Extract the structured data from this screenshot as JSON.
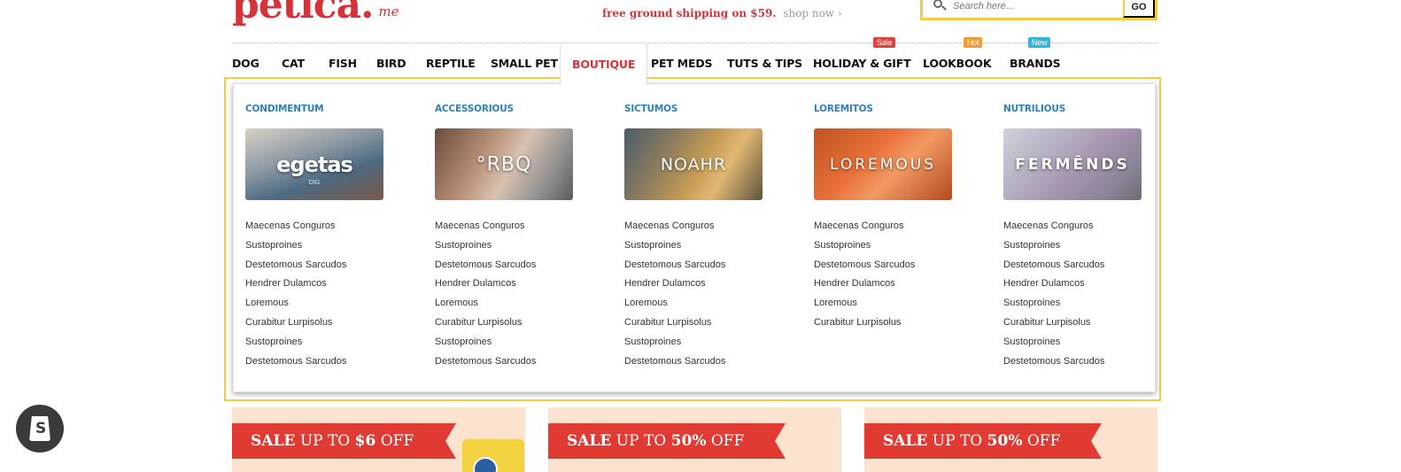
{
  "header": {
    "logo_text": "petica.",
    "logo_suffix": "me",
    "promo_red": "free ground shipping on $59.",
    "promo_link": "shop now ›",
    "search_placeholder": "Search here...",
    "search_button": "GO"
  },
  "nav": {
    "items": [
      {
        "label": "DOG"
      },
      {
        "label": "CAT"
      },
      {
        "label": "FISH"
      },
      {
        "label": "BIRD"
      },
      {
        "label": "REPTILE"
      },
      {
        "label": "SMALL PET"
      },
      {
        "label": "BOUTIQUE",
        "active": true
      },
      {
        "label": "PET MEDS"
      },
      {
        "label": "TUTS & TIPS"
      },
      {
        "label": "HOLIDAY & GIFT",
        "badge": "Sale"
      },
      {
        "label": "LOOKBOOK",
        "badge": "Hot"
      },
      {
        "label": "BRANDS",
        "badge": "New"
      }
    ]
  },
  "badge_colors": {
    "Sale": "#e0423e",
    "Hot": "#f09a3a",
    "New": "#2fb5e0"
  },
  "mega_menu": {
    "columns": [
      {
        "title": "CONDIMENTUM",
        "banner_text": "egetas",
        "banner_sub": "DIG",
        "links": [
          "Maecenas Conguros",
          "Sustoproines",
          "Destetomous Sarcudos",
          "Hendrer Dulamcos",
          "Loremous",
          "Curabitur Lurpisolus",
          "Sustoproines",
          "Destetomous Sarcudos"
        ]
      },
      {
        "title": "ACCESSORIOUS",
        "banner_text": "°RBQ",
        "links": [
          "Maecenas Conguros",
          "Sustoproines",
          "Destetomous Sarcudos",
          "Hendrer Dulamcos",
          "Loremous",
          "Curabitur Lurpisolus",
          "Sustoproines",
          "Destetomous Sarcudos"
        ]
      },
      {
        "title": "SICTUMOS",
        "banner_text": "NOAHR",
        "links": [
          "Maecenas Conguros",
          "Sustoproines",
          "Destetomous Sarcudos",
          "Hendrer Dulamcos",
          "Loremous",
          "Curabitur Lurpisolus",
          "Sustoproines",
          "Destetomous Sarcudos"
        ]
      },
      {
        "title": "LOREMITOS",
        "banner_text": "LOREMOUS",
        "links": [
          "Maecenas Conguros",
          "Sustoproines",
          "Destetomous Sarcudos",
          "Hendrer Dulamcos",
          "Loremous",
          "Curabitur Lurpisolus"
        ]
      },
      {
        "title": "NUTRILIOUS",
        "banner_text": "FERMĒNDS",
        "links": [
          "Maecenas Conguros",
          "Sustoproines",
          "Destetomous Sarcudos",
          "Hendrer Dulamcos",
          "Sustoproines",
          "Curabitur Lurpisolus",
          "Sustoproines",
          "Destetomous Sarcudos"
        ]
      }
    ]
  },
  "sales": [
    {
      "prefix": "SALE",
      "text": "UP TO",
      "amount": "$6",
      "suffix": "OFF"
    },
    {
      "prefix": "SALE",
      "text": "UP TO",
      "amount": "50%",
      "suffix": "OFF"
    },
    {
      "prefix": "SALE",
      "text": "UP TO",
      "amount": "50%",
      "suffix": "OFF"
    }
  ],
  "colors": {
    "brand_red": "#d6323a",
    "highlight_yellow": "#f0cd47",
    "link_blue": "#2f7fb5"
  },
  "icons": {
    "search": "search-icon",
    "shopify": "shopify-bag-icon"
  }
}
